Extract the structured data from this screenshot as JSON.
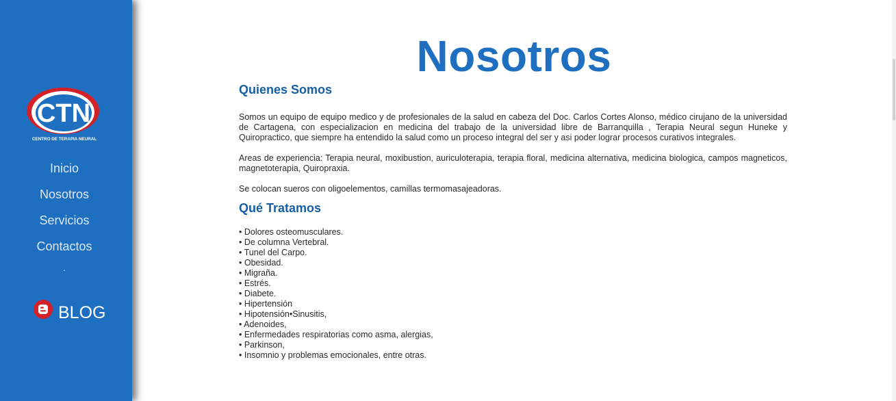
{
  "logo": {
    "text": "CTN",
    "subtitle": "CENTRO DE TERAPIA NEURAL"
  },
  "nav": {
    "items": [
      "Inicio",
      "Nosotros",
      "Servicios",
      "Contactos"
    ],
    "dot": "."
  },
  "blog": {
    "label": "BLOG",
    "icon": "blogger-icon"
  },
  "page": {
    "title": "Nosotros"
  },
  "quienes": {
    "heading": "Quienes Somos",
    "p1": "Somos un equipo de equipo medico y de profesionales de la salud en cabeza del Doc. Carlos Cortes Alonso, médico cirujano de la universidad de Cartagena, con especializacion en medicina del trabajo de la universidad libre de Barranquilla , Terapia Neural segun Huneke y Quiropractico, que siempre ha entendido la salud como un proceso integral del ser y asi poder lograr procesos curativos integrales.",
    "p2": "Areas de experiencia: Terapia neural, moxibustion, auriculoterapia, terapia floral, medicina alternativa, medicina biologica, campos magneticos, magnetoterapia, Quiropraxia.",
    "p3": "Se colocan sueros con oligoelementos, camillas termomasajeadoras."
  },
  "tratamos": {
    "heading": "Qué Tratamos",
    "items": [
      "• Dolores osteomusculares.",
      "• De columna Vertebral.",
      "• Tunel del Carpo.",
      "• Obesidad.",
      "• Migraña.",
      "• Estrés.",
      "• Diabete.",
      "• Hipertensión",
      "• Hipotensión•Sinusitis,",
      "• Adenoides,",
      "• Enfermedades respiratorias como asma, alergias,",
      "• Parkinson,",
      "• Insomnio y problemas emocionales, entre otras."
    ]
  },
  "colors": {
    "sidebar": "#1f6fc0",
    "accent": "#155ea6",
    "logo_red": "#d42027"
  }
}
